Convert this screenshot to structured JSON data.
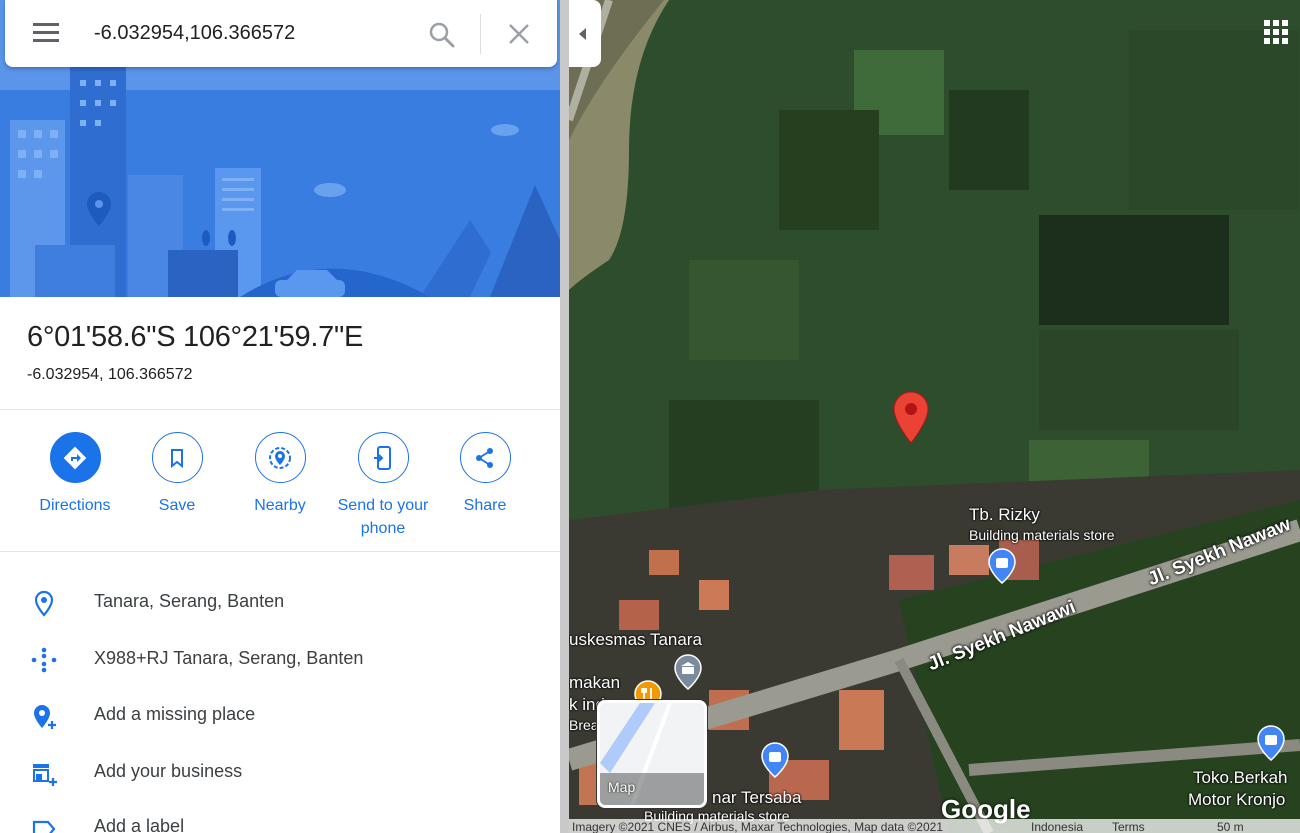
{
  "search": {
    "query": "-6.032954,106.366572",
    "menu_icon": "hamburger-menu-icon",
    "search_icon": "search-icon",
    "close_icon": "close-icon"
  },
  "place": {
    "dms": "6°01'58.6\"S 106°21'59.7\"E",
    "decimal": "-6.032954, 106.366572"
  },
  "actions": [
    {
      "label": "Directions",
      "icon": "directions-icon"
    },
    {
      "label": "Save",
      "icon": "bookmark-icon"
    },
    {
      "label": "Nearby",
      "icon": "nearby-icon"
    },
    {
      "label": "Send to your phone",
      "icon": "send-to-phone-icon"
    },
    {
      "label": "Share",
      "icon": "share-icon"
    }
  ],
  "details": [
    {
      "text": "Tanara, Serang, Banten",
      "icon": "location-pin-icon"
    },
    {
      "text": "X988+RJ Tanara, Serang, Banten",
      "icon": "plus-code-icon"
    },
    {
      "text": "Add a missing place",
      "icon": "add-place-icon"
    },
    {
      "text": "Add your business",
      "icon": "add-business-icon"
    },
    {
      "text": "Add a label",
      "icon": "label-icon"
    }
  ],
  "map": {
    "labels": {
      "store_name": "Tb. Rizky",
      "store_type": "Building materials store",
      "road1": "Jl. Syekh Nawawi",
      "road2": "Jl. Syekh Nawaw",
      "puskesmas": "uskesmas Tanara",
      "makan": "makan",
      "k_ind": "k ind",
      "break": "Break",
      "tersaba": "nar Tersaba",
      "tersaba_type": "Building materials store",
      "toko1": "Toko.Berkah",
      "toko2": "Motor Kronjo"
    },
    "minimap_label": "Map",
    "google_logo": "Google",
    "attribution": {
      "imagery": "Imagery ©2021 CNES / Airbus, Maxar Technologies, Map data ©2021",
      "country": "Indonesia",
      "terms": "Terms",
      "scale": "50 m"
    },
    "pin_color": "#ea4335"
  },
  "colors": {
    "accent": "#1a73e8",
    "hero_bg": "#3a7de0"
  }
}
